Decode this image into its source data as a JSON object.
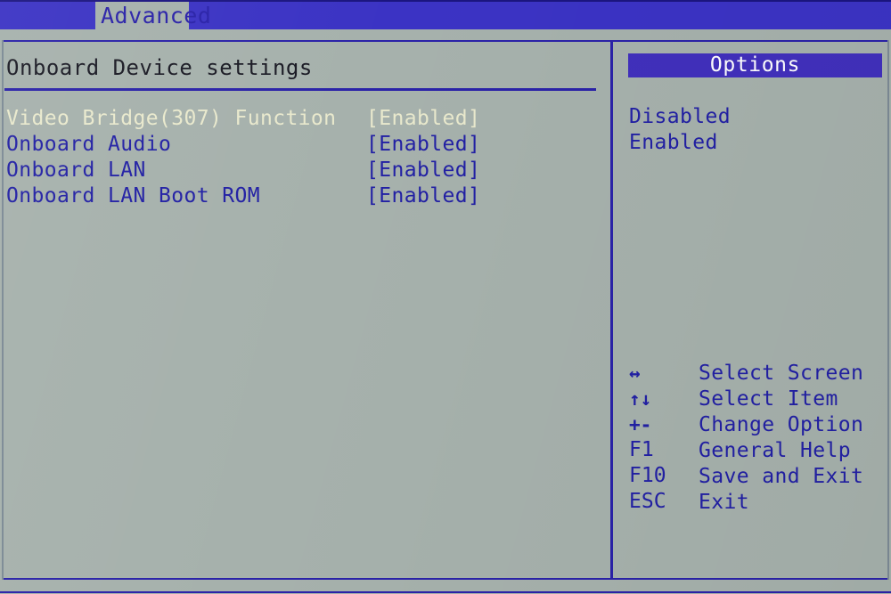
{
  "menubar": {
    "tabs": [
      {
        "label": "Advanced",
        "active": true
      }
    ]
  },
  "main": {
    "title": "Onboard Device settings",
    "settings": [
      {
        "label": "Video Bridge(307) Function",
        "value": "[Enabled]",
        "selected": true
      },
      {
        "label": "Onboard Audio",
        "value": "[Enabled]",
        "selected": false
      },
      {
        "label": "Onboard LAN",
        "value": "[Enabled]",
        "selected": false
      },
      {
        "label": "Onboard LAN Boot ROM",
        "value": "[Enabled]",
        "selected": false
      }
    ]
  },
  "options_panel": {
    "header": "Options",
    "items": [
      {
        "label": "Disabled"
      },
      {
        "label": "Enabled"
      }
    ]
  },
  "key_legend": [
    {
      "key": "↔",
      "icon": "left-right-arrow-icon",
      "desc": "Select Screen"
    },
    {
      "key": "↑↓",
      "icon": "up-down-arrow-icon",
      "desc": "Select Item"
    },
    {
      "key": "+-",
      "icon": "plus-minus-icon",
      "desc": "Change Option"
    },
    {
      "key": "F1",
      "icon": "f1-key-icon",
      "desc": "General Help"
    },
    {
      "key": "F10",
      "icon": "f10-key-icon",
      "desc": "Save and Exit"
    },
    {
      "key": "ESC",
      "icon": "esc-key-icon",
      "desc": "Exit"
    }
  ],
  "colors": {
    "background": "#a6b1ac",
    "menubar": "#3b33c4",
    "accent_blue": "#2220a4",
    "options_header": "#4130bc",
    "selected_text": "#e9e9cd",
    "title_text": "#1a1a24"
  }
}
